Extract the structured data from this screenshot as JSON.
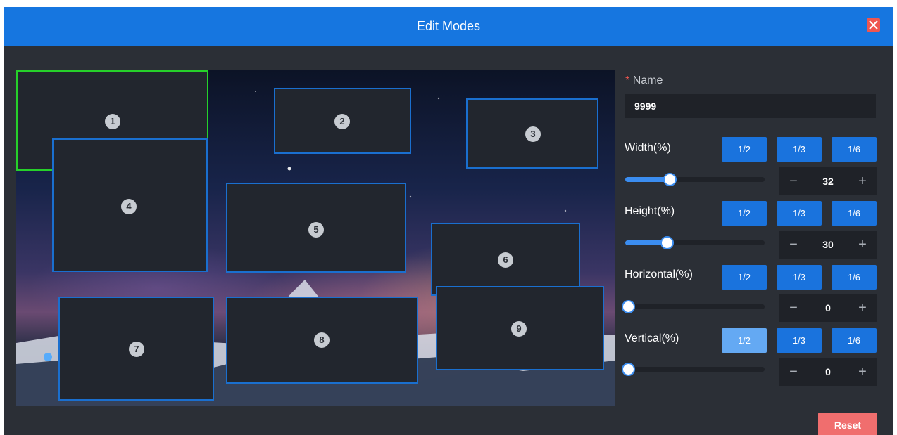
{
  "dialog": {
    "title": "Edit Modes",
    "close_icon": "close-icon",
    "accent": "#1676e0",
    "close_color": "#ef5650"
  },
  "regions": [
    {
      "number": "1",
      "selected": true
    },
    {
      "number": "2",
      "selected": false
    },
    {
      "number": "3",
      "selected": false
    },
    {
      "number": "4",
      "selected": false
    },
    {
      "number": "5",
      "selected": false
    },
    {
      "number": "6",
      "selected": false
    },
    {
      "number": "7",
      "selected": false
    },
    {
      "number": "8",
      "selected": false
    },
    {
      "number": "9",
      "selected": false
    }
  ],
  "form": {
    "name": {
      "required_mark": "*",
      "label": "Name",
      "value": "9999"
    },
    "width": {
      "label": "Width(%)",
      "fractions": [
        "1/2",
        "1/3",
        "1/6"
      ],
      "value": "32",
      "minus": "−",
      "plus": "+"
    },
    "height": {
      "label": "Height(%)",
      "fractions": [
        "1/2",
        "1/3",
        "1/6"
      ],
      "value": "30",
      "minus": "−",
      "plus": "+"
    },
    "horizontal": {
      "label": "Horizontal(%)",
      "fractions": [
        "1/2",
        "1/3",
        "1/6"
      ],
      "value": "0",
      "minus": "−",
      "plus": "+"
    },
    "vertical": {
      "label": "Vertical(%)",
      "fractions": [
        "1/2",
        "1/3",
        "1/6"
      ],
      "value": "0",
      "minus": "−",
      "plus": "+",
      "highlighted_fraction": "1/2"
    },
    "reset_label": "Reset"
  },
  "colors": {
    "selected_border": "#26d02a",
    "region_border": "#1a6fcf",
    "button": "#1a73dd",
    "reset": "#f06e6e"
  }
}
